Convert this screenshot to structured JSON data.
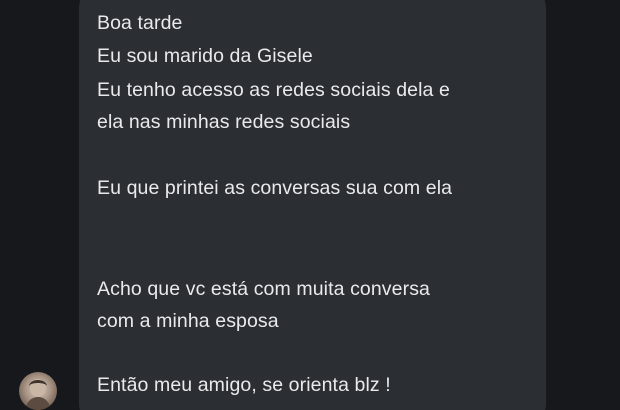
{
  "message": {
    "lines": [
      "Boa tarde",
      "Eu sou marido da Gisele",
      "Eu tenho acesso as redes sociais dela e",
      "ela nas minhas redes sociais",
      "Eu que printei as conversas sua com ela",
      "Acho que vc está com muita conversa",
      "com a minha esposa",
      "Então meu amigo, se orienta blz !"
    ]
  },
  "colors": {
    "background": "#16181b",
    "bubble": "#2b2e33",
    "text": "#e9eaec"
  },
  "avatar": {
    "icon": "contact-avatar-photo"
  }
}
